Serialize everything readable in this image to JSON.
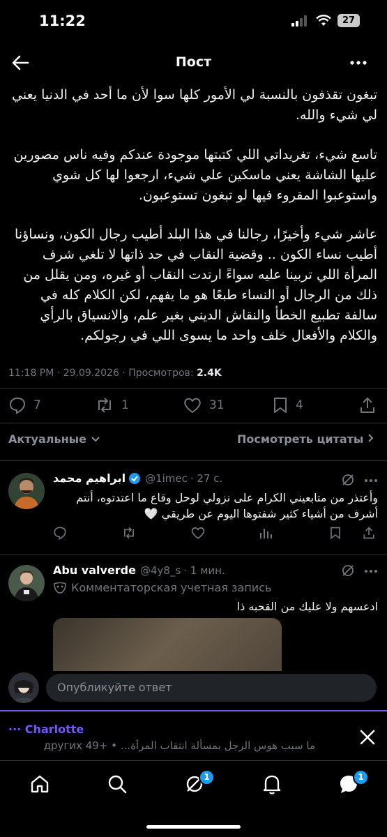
{
  "status_bar": {
    "time": "11:22",
    "battery": "27"
  },
  "header": {
    "title": "Пост"
  },
  "post": {
    "paragraphs": [
      "تبغون تقذفون بالنسبة لي الأمور كلها سوا لأن ما أحد في الدنيا يعني لي شيء والله.",
      "تاسع شيء، تغريداتي اللي كتبتها موجودة عندكم وفيه ناس مصورين عليها الشاشة يعني ماسكين علي شيء، ارجعوا لها كل شوي واستوعبوا المقروء فيها لو تبغون تستوعبون.",
      "عاشر شيء وأخيرًا، رجالنا في هذا البلد أطيب رجال الكون، ونساؤنا أطيب نساء الكون .. وقضية النقاب في حد ذاتها لا تلغي شرف المرأة اللي تربينا عليه سواءً ارتدت النقاب أو غيره، ومن يقلل من ذلك من الرجال أو النساء طبعًا هو ما يفهم، لكن الكلام كله في سالفة تطبيع الخطأ والنقاش الديني بغير علم، والانسياق بالرأي والكلام والأفعال خلف واحد ما يسوى اللي في رجولكم."
    ],
    "time": "11:18 PM",
    "date": "29.09.2026",
    "views_label": "Просмотров:",
    "views": "2.4K",
    "replies": "7",
    "reposts": "1",
    "likes": "31",
    "bookmarks": "4"
  },
  "sort": {
    "left": "Актуальные",
    "right": "Посмотреть цитаты"
  },
  "replies": [
    {
      "name": "ابراهيم محمد",
      "verified": true,
      "handle": "@1imec",
      "age": "· 27 с.",
      "text": "وأعتذر من متابعيني الكرام على نزولي لوحل وقاع ما اعتدتوه، أنتم أشرف من أشياء كثير شفتوها اليوم عن طريقي 🤍"
    },
    {
      "name": "Abu valverde",
      "handle": "@4y8_s",
      "age": "· 1 мин.",
      "label": "Комментаторская учетная запись",
      "text": "ادعسهم ولا عليك من القحبه ذا"
    }
  ],
  "composer": {
    "placeholder": "Опубликуйте ответ"
  },
  "dm_bar": {
    "title": "··· Charlotte",
    "subtitle": "ما سبب هوس الرجل بمسألة انتقاب المرأة... • +49 других"
  },
  "tabbar": {
    "grok_badge": "1",
    "messages_badge": "1"
  },
  "colors": {
    "accent": "#1d9bf0",
    "dm_accent": "#7856ff",
    "muted": "#71767b"
  }
}
